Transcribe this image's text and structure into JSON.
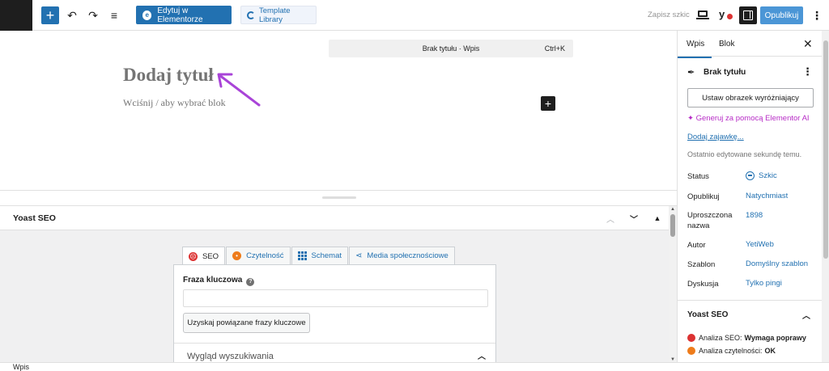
{
  "toolbar": {
    "add_icon": "plus-icon",
    "undo_icon": "undo-icon",
    "redo_icon": "redo-icon",
    "outline_icon": "list-view-icon",
    "elementor_button": "Edytuj w Elementorze",
    "template_button": "Template Library",
    "save_draft": "Zapisz szkic",
    "publish_button": "Opublikuj",
    "publish_color": "#4b96d6",
    "accent_color": "#2271b1"
  },
  "editor": {
    "command_bar_title": "Brak tytułu · Wpis",
    "command_bar_shortcut": "Ctrl+K",
    "title_placeholder": "Dodaj tytuł",
    "block_placeholder": "Wciśnij / aby wybrać blok",
    "arrow_color": "#a944d8"
  },
  "metabox": {
    "title": "Yoast SEO",
    "tabs": [
      {
        "label": "SEO",
        "icon": "sad-face-icon"
      },
      {
        "label": "Czytelność",
        "icon": "neutral-face-icon"
      },
      {
        "label": "Schemat",
        "icon": "grid-icon"
      },
      {
        "label": "Media społecznościowe",
        "icon": "share-icon"
      }
    ],
    "keyphrase_label": "Fraza kluczowa",
    "keyphrase_value": "",
    "related_button": "Uzyskaj powiązane frazy kluczowe",
    "search_appearance": "Wygląd wyszukiwania"
  },
  "statusbar": {
    "breadcrumb": "Wpis"
  },
  "sidebar": {
    "tab_post": "Wpis",
    "tab_block": "Blok",
    "doc_title": "Brak tytułu",
    "featured_image_button": "Ustaw obrazek wyróżniający",
    "ai_link": "Generuj za pomocą Elementor AI",
    "excerpt_link": "Dodaj zajawkę...",
    "last_edited": "Ostatnio edytowane sekundę temu.",
    "properties": [
      {
        "label": "Status",
        "value": "Szkic"
      },
      {
        "label": "Opublikuj",
        "value": "Natychmiast"
      },
      {
        "label": "Uproszczona nazwa",
        "value": "1898"
      },
      {
        "label": "Autor",
        "value": "YetiWeb"
      },
      {
        "label": "Szablon",
        "value": "Domyślny szablon"
      },
      {
        "label": "Dyskusja",
        "value": "Tylko pingi"
      }
    ],
    "yoast_title": "Yoast SEO",
    "analysis": [
      {
        "label": "Analiza SEO:",
        "value": "Wymaga poprawy",
        "color": "#dc3232"
      },
      {
        "label": "Analiza czytelności:",
        "value": "OK",
        "color": "#ee7c1b"
      }
    ]
  }
}
